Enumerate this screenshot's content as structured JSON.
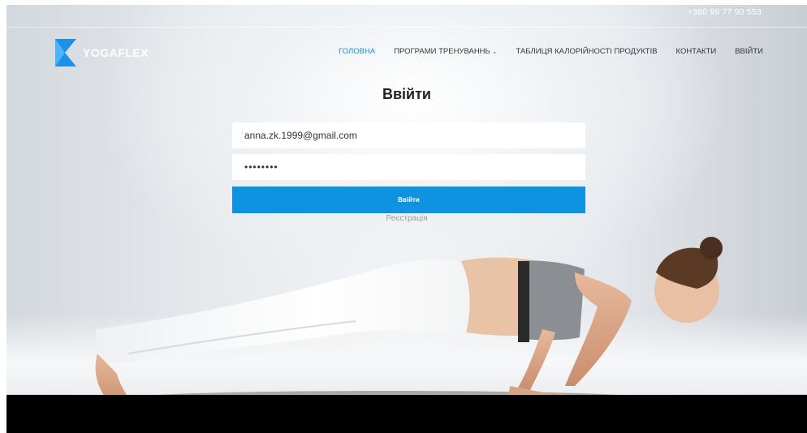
{
  "header": {
    "phone": "+380 99 77 90 553",
    "brand": "YOGAFLEX"
  },
  "nav": {
    "items": [
      {
        "label": "ГОЛОВНА",
        "active": true
      },
      {
        "label": "ПРОГРАМИ ТРЕНУВАННЬ",
        "has_dropdown": true
      },
      {
        "label": "ТАБЛИЦЯ КАЛОРІЙНОСТІ ПРОДУКТІВ"
      },
      {
        "label": "КОНТАКТИ"
      },
      {
        "label": "ВВІЙТИ"
      }
    ],
    "dropdown_icon": "chevron-down-icon"
  },
  "login": {
    "title": "Ввійти",
    "email_value": "anna.zk.1999@gmail.com",
    "password_value": "••••••••",
    "submit_label": "Ввійти",
    "register_link": "Реєстрація"
  },
  "colors": {
    "accent": "#0e93e0",
    "nav_active": "#1a8fdc",
    "logo_blue": "#1e90e6"
  }
}
